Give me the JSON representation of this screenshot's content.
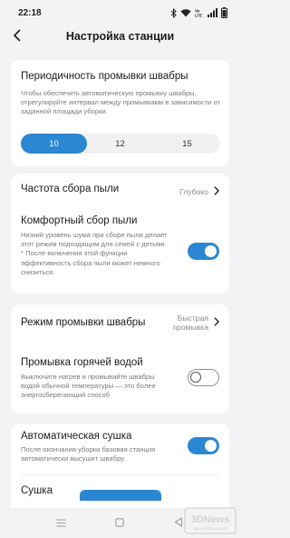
{
  "status_bar": {
    "time": "22:18",
    "icons": [
      "bluetooth-icon",
      "wifi-icon",
      "volte-icon",
      "signal-icon",
      "battery-icon"
    ],
    "volte_label": "Vo LTE"
  },
  "header": {
    "title": "Настройка станции",
    "back_icon": "chevron-left-icon"
  },
  "mop_wash_interval": {
    "title": "Периодичность промывки швабры",
    "description": "Чтобы обеспечить автоматическую промывку швабры, отрегулируйте интервал между промывками в зависимости от заданной площади уборки.",
    "options": [
      "10",
      "12",
      "15"
    ],
    "selected": "10"
  },
  "dust_collection_frequency": {
    "title": "Частота сбора пыли",
    "value": "Глубоко"
  },
  "comfort_dust_collection": {
    "title": "Комфортный сбор пыли",
    "description": "Низкий уровень шума при сборе пыли делает этот режим подходящим для семей с детьми.\n* После включения этой функции эффективность сбора пыли может немного снизиться.",
    "enabled": true
  },
  "mop_wash_mode": {
    "title": "Режим промывки швабры",
    "value_line1": "Быстрая",
    "value_line2": "промывка"
  },
  "hot_water_wash": {
    "title": "Промывка горячей водой",
    "description": "Выключите нагрев и промывайте швабры водой обычной температуры — это более энергосберегающий способ",
    "enabled": false
  },
  "auto_drying": {
    "title": "Автоматическая сушка",
    "description": "После окончания уборки базовая станция автоматически высушит швабру.",
    "enabled": true
  },
  "drying": {
    "title": "Сушка"
  },
  "nav_bar": {
    "icons": [
      "menu-icon",
      "home-square-icon",
      "back-triangle-icon"
    ]
  },
  "watermark": {
    "text": "3DNews",
    "subtext": "DAILY DIGITAL DIGEST"
  },
  "colors": {
    "accent": "#2b87d1",
    "background": "#f3f3f5",
    "card": "#ffffff",
    "secondary_text": "#7a7a7a"
  }
}
